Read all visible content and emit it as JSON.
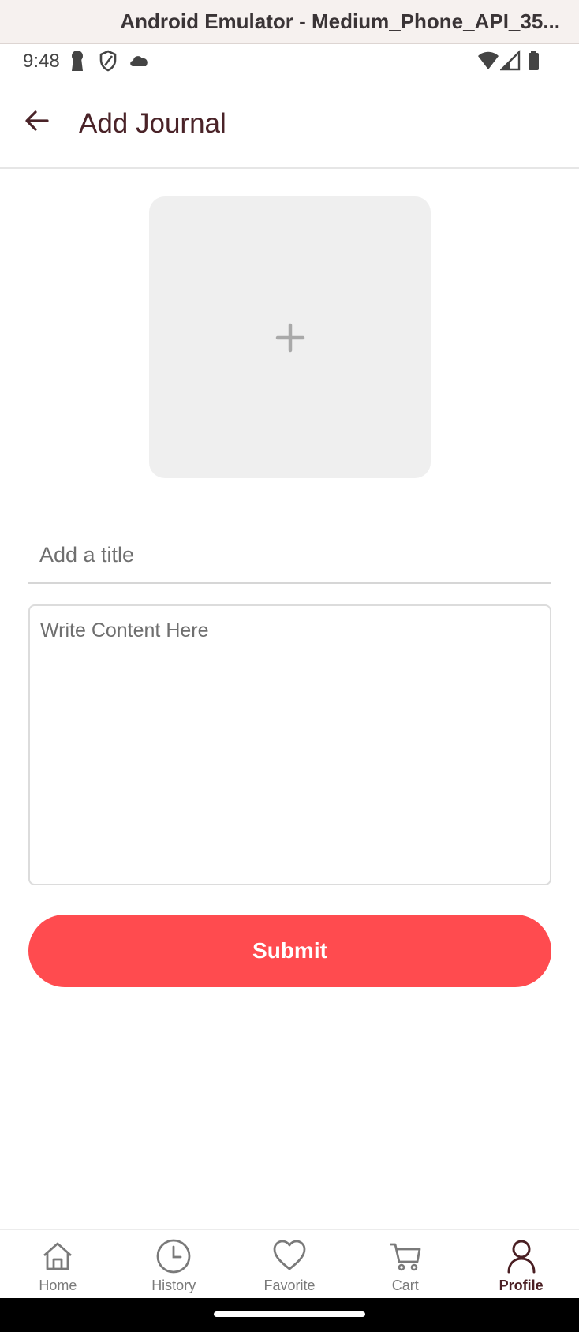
{
  "window": {
    "title": "Android Emulator - Medium_Phone_API_35..."
  },
  "status_bar": {
    "time": "9:48",
    "left_icons": [
      "keyhole-icon",
      "shield-icon",
      "cloud-icon"
    ],
    "right_icons": [
      "wifi-icon",
      "signal-icon",
      "battery-icon"
    ]
  },
  "app_bar": {
    "title": "Add Journal",
    "back_icon": "arrow-back-icon"
  },
  "form": {
    "image_picker_icon": "plus-icon",
    "title_placeholder": "Add a title",
    "title_value": "",
    "content_placeholder": "Write Content Here",
    "content_value": "",
    "submit_label": "Submit"
  },
  "bottom_nav": {
    "active": "Profile",
    "items": [
      {
        "label": "Home",
        "icon": "home-icon"
      },
      {
        "label": "History",
        "icon": "clock-icon"
      },
      {
        "label": "Favorite",
        "icon": "heart-icon"
      },
      {
        "label": "Cart",
        "icon": "cart-icon"
      },
      {
        "label": "Profile",
        "icon": "person-icon"
      }
    ]
  },
  "colors": {
    "accent": "#ff4b4f",
    "title_text": "#4a2328",
    "placeholder_text": "#6f6f6f",
    "image_picker_bg": "#efefef",
    "nav_inactive": "#7a7a7a",
    "nav_active": "#4a1f23"
  }
}
